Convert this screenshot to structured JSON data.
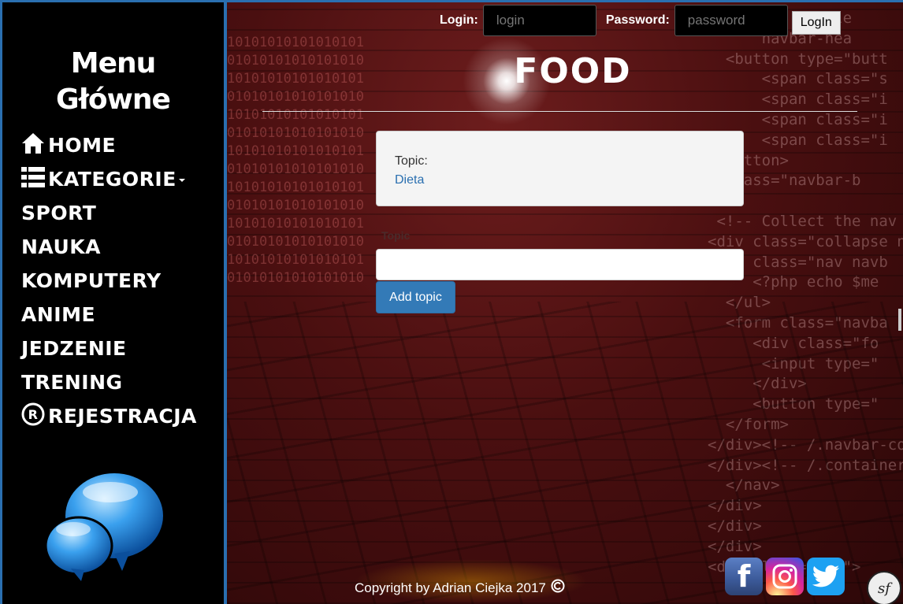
{
  "sidebar": {
    "title_line1": "Menu",
    "title_line2": "Główne",
    "items": [
      {
        "label": "Home",
        "icon": "home-icon"
      },
      {
        "label": "Kategorie",
        "icon": "list-icon"
      },
      {
        "label": "Sport"
      },
      {
        "label": "Nauka"
      },
      {
        "label": "Komputery"
      },
      {
        "label": "Anime"
      },
      {
        "label": "Jedzenie"
      },
      {
        "label": "Trening"
      },
      {
        "label": "Rejestracja",
        "icon": "registered-icon"
      }
    ],
    "logo_icon": "chat-bubbles-icon"
  },
  "header": {
    "login_label": "Login:",
    "login_placeholder": "login",
    "password_label": "Password:",
    "password_placeholder": "password",
    "login_button": "LogIn",
    "title": "FOOD"
  },
  "main": {
    "card_key": "Topic:",
    "card_value": "Dieta",
    "topic_label": "Topic",
    "topic_value": "",
    "add_button": "Add topic"
  },
  "footer": {
    "copyright": "Copyright by Adrian Ciejka 2017",
    "copyright_icon": "copyright-icon",
    "social": [
      "facebook-icon",
      "instagram-icon",
      "twitter-icon"
    ],
    "symfony_icon": "symfony-icon"
  },
  "colors": {
    "sidebar_bg": "#000000",
    "accent_blue": "#337ab7",
    "link_blue": "#2a6fb0",
    "background_red": "#4a0f10"
  }
}
